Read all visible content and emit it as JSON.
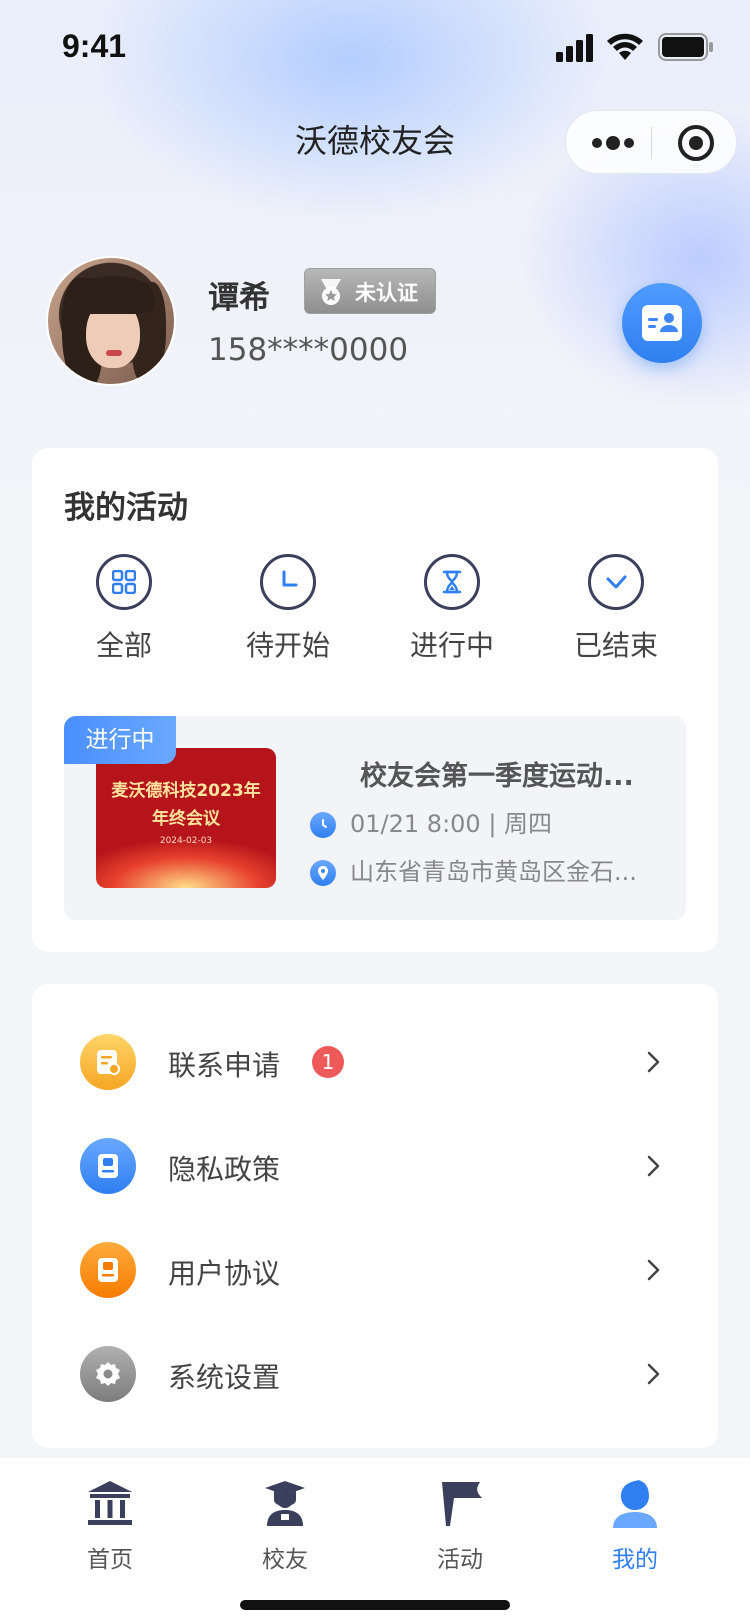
{
  "status": {
    "time": "9:41"
  },
  "nav": {
    "title": "沃德校友会"
  },
  "profile": {
    "name": "谭希",
    "badge": "未认证",
    "phone": "158****0000"
  },
  "activity": {
    "title": "我的活动",
    "filters": [
      {
        "label": "全部",
        "icon": "grid-icon"
      },
      {
        "label": "待开始",
        "icon": "clock-icon"
      },
      {
        "label": "进行中",
        "icon": "hourglass-icon"
      },
      {
        "label": "已结束",
        "icon": "check-icon"
      }
    ],
    "event": {
      "tag": "进行中",
      "poster_line1": "麦沃德科技2023年",
      "poster_line2": "年终会议",
      "poster_date": "2024-02-03",
      "title": "校友会第一季度运动...",
      "time": "01/21 8:00 | 周四",
      "location": "山东省青岛市黄岛区金石..."
    }
  },
  "menu": [
    {
      "label": "联系申请",
      "badge": "1",
      "icon": "contact-request-icon",
      "color": "#f7b733"
    },
    {
      "label": "隐私政策",
      "icon": "privacy-document-icon",
      "color": "#3f86f5"
    },
    {
      "label": "用户协议",
      "icon": "agreement-document-icon",
      "color": "#f88a0e"
    },
    {
      "label": "系统设置",
      "icon": "settings-gear-icon",
      "color": "#8b8b8b"
    }
  ],
  "tabs": [
    {
      "label": "首页",
      "icon": "home-building-icon"
    },
    {
      "label": "校友",
      "icon": "alumni-graduate-icon"
    },
    {
      "label": "活动",
      "icon": "activity-flag-icon"
    },
    {
      "label": "我的",
      "icon": "profile-person-icon",
      "active": true
    }
  ],
  "colors": {
    "accent": "#2f7ff0",
    "badge_red": "#ee5a5a"
  }
}
